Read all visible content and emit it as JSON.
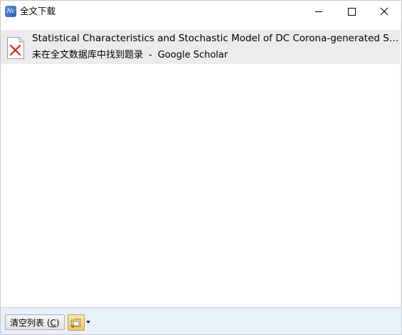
{
  "window": {
    "app_icon_text": "Nc",
    "title": "全文下载"
  },
  "list": {
    "items": [
      {
        "icon": "pdf-error-icon",
        "title": "Statistical Characteristics and Stochastic Model of DC Corona-generated Sound Pressure Pulses from an Ungrounded Conductor",
        "status": "未在全文数据库中找到题录",
        "separator": "-",
        "source": "Google Scholar"
      }
    ]
  },
  "toolbar": {
    "clear_label": "清空列表",
    "clear_hotkey_open": " (",
    "clear_hotkey": "C",
    "clear_hotkey_close": ")",
    "tool_icon": "folder-download-icon"
  },
  "colors": {
    "selection_bg": "#ececec",
    "bottom_bar_bg": "#e8f0f9",
    "error_x": "#d9231d"
  }
}
